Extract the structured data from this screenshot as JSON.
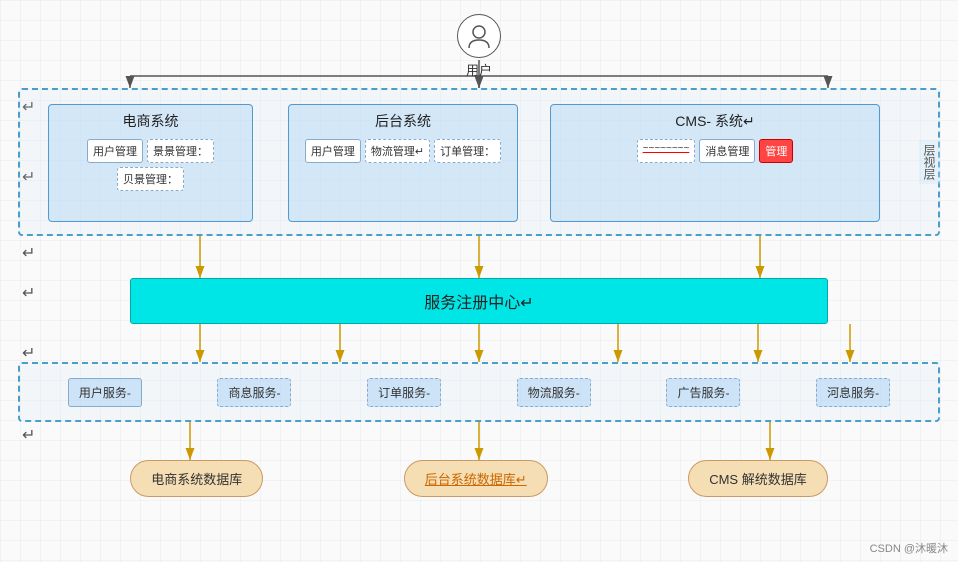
{
  "user": {
    "label": "用户"
  },
  "systems_outer": {
    "layer_label": "层视层"
  },
  "ecommerce": {
    "title": "电商系统",
    "modules": [
      "用户管理",
      "景景管理：",
      "贝景管理："
    ]
  },
  "backend": {
    "title": "后台系统",
    "modules": [
      "用户管理",
      "物流管理↵",
      "订单管理："
    ]
  },
  "cms": {
    "title": "CMS-系统↵",
    "modules": [
      "消息管理",
      "管理"
    ]
  },
  "service_registry": {
    "label": "服务注册中心↵"
  },
  "services": {
    "items": [
      "用户服务-",
      "商息服务-",
      "订单服务-",
      "物流服务-",
      "广告服务-",
      "河息服务-"
    ]
  },
  "databases": [
    {
      "label": "电商系统数据库"
    },
    {
      "label": "后台系统数据库↵",
      "style": "orange"
    },
    {
      "label": "CMS 解统数据库"
    }
  ],
  "watermark": "CSDN @沐暖沐"
}
